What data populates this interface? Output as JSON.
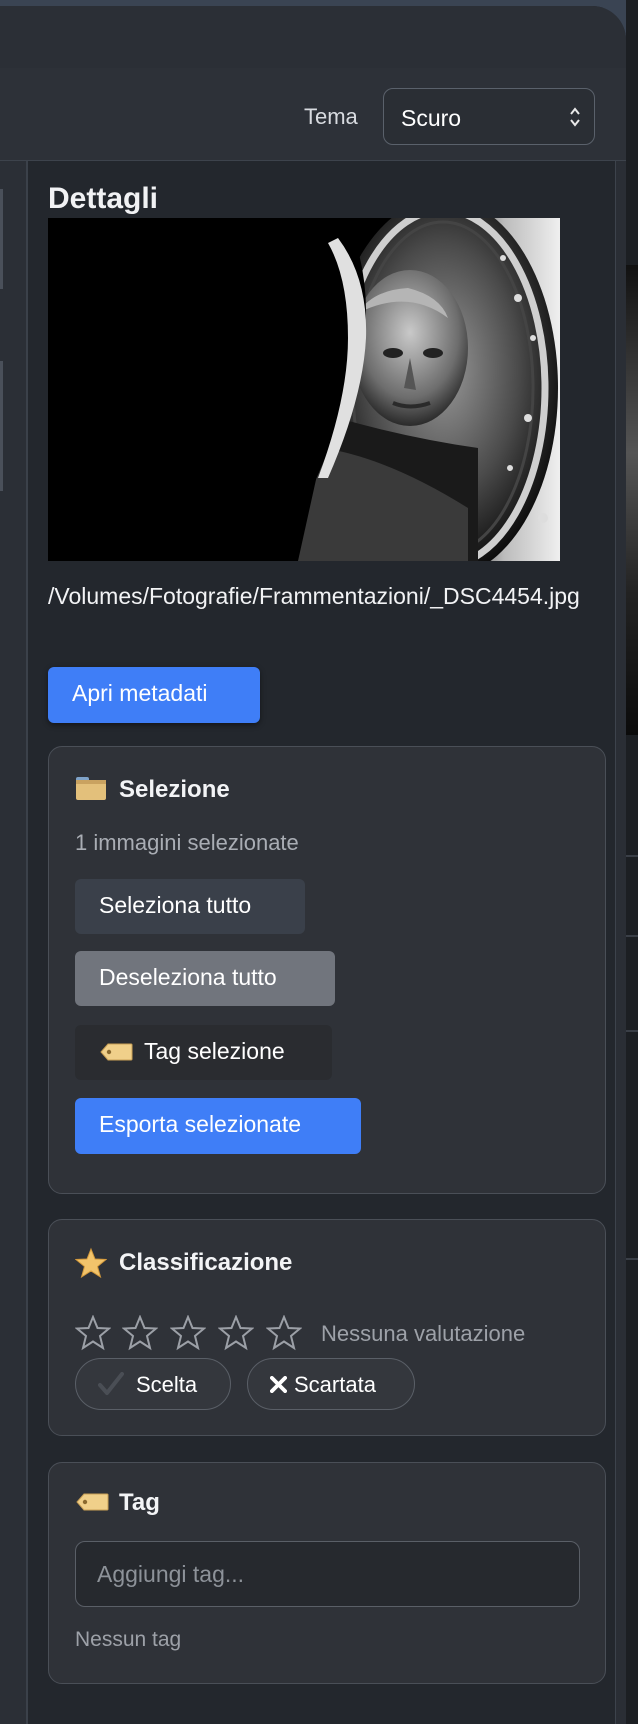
{
  "toolbar": {
    "theme_label": "Tema",
    "theme_value": "Scuro",
    "theme_options": [
      "Scuro"
    ]
  },
  "details": {
    "title": "Dettagli",
    "file_path": "/Volumes/Fotografie/Frammentazioni/_DSC4454.jpg",
    "open_metadata_label": "Apri metadati"
  },
  "selection": {
    "icon": "folder-icon",
    "title": "Selezione",
    "count_text": "1 immagini selezionate",
    "select_all_label": "Seleziona tutto",
    "deselect_all_label": "Deseleziona tutto",
    "tag_selection_label": "Tag selezione",
    "export_selected_label": "Esporta selezionate"
  },
  "rating": {
    "icon": "star-icon",
    "title": "Classificazione",
    "stars_max": 5,
    "stars_value": 0,
    "no_rating_text": "Nessuna valutazione",
    "pick_label": "Scelta",
    "reject_label": "Scartata"
  },
  "tags": {
    "icon": "tag-icon",
    "title": "Tag",
    "input_placeholder": "Aggiungi tag...",
    "input_value": "",
    "empty_text": "Nessun tag"
  },
  "colors": {
    "accent": "#3f7ef7",
    "background": "#23272d",
    "card": "#2f3238",
    "tag_label": "#f0d08a"
  }
}
